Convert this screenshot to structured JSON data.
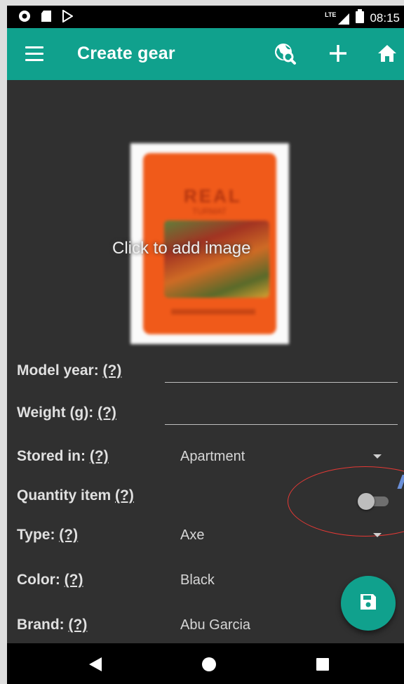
{
  "statusbar": {
    "network": "LTE",
    "time": "08:15",
    "icons": [
      "record-icon",
      "sd-card-icon",
      "play-store-icon",
      "signal-icon",
      "battery-icon"
    ]
  },
  "appbar": {
    "title": "Create gear",
    "color": "#10a18d",
    "actions": [
      "search-web-icon",
      "add-icon",
      "home-icon"
    ]
  },
  "image": {
    "label": "Click to add image",
    "pouch_brand": "REAL",
    "pouch_subtitle": "TURMAT"
  },
  "form": {
    "model_year": {
      "label": "Model year:",
      "help": "(?)",
      "value": ""
    },
    "weight": {
      "label": "Weight (g):",
      "help": "(?)",
      "value": ""
    },
    "stored_in": {
      "label": "Stored in:",
      "help": "(?)",
      "value": "Apartment"
    },
    "quantity_item": {
      "label": "Quantity item",
      "help": "(?)",
      "toggle_on": false
    },
    "type": {
      "label": "Type:",
      "help": "(?)",
      "value": "Axe"
    },
    "color": {
      "label": "Color:",
      "help": "(?)",
      "value": "Black"
    },
    "brand": {
      "label": "Brand:",
      "help": "(?)",
      "value": "Abu Garcia"
    }
  },
  "fab": {
    "icon": "save-icon"
  },
  "navbar": {
    "buttons": [
      "back-icon",
      "home-circle-icon",
      "recents-icon"
    ]
  }
}
